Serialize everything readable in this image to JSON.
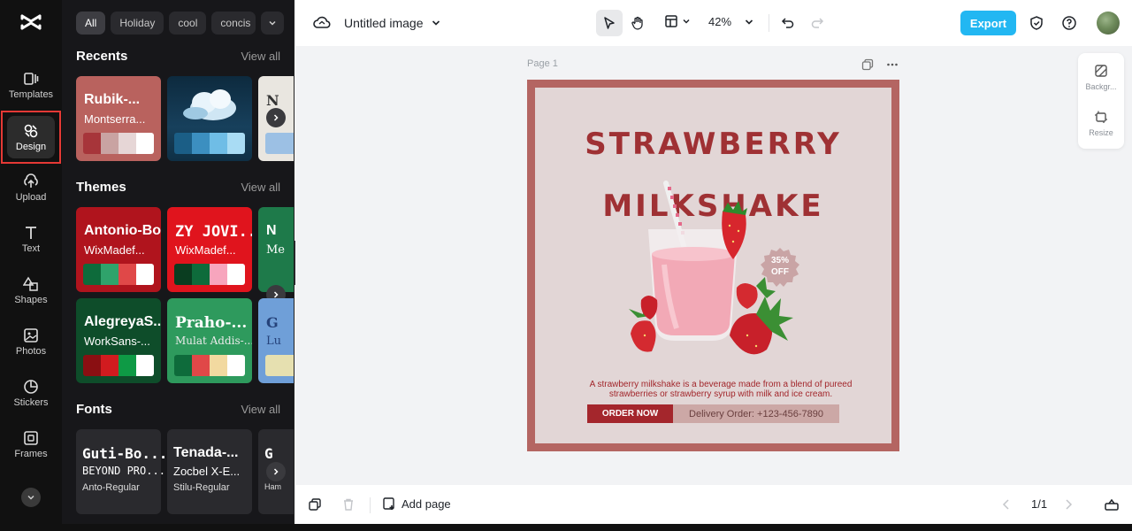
{
  "rail": {
    "items": [
      {
        "label": "Templates",
        "icon": "templates-icon"
      },
      {
        "label": "Design",
        "icon": "design-icon"
      },
      {
        "label": "Upload",
        "icon": "upload-icon"
      },
      {
        "label": "Text",
        "icon": "text-icon"
      },
      {
        "label": "Shapes",
        "icon": "shapes-icon"
      },
      {
        "label": "Photos",
        "icon": "photos-icon"
      },
      {
        "label": "Stickers",
        "icon": "stickers-icon"
      },
      {
        "label": "Frames",
        "icon": "frames-icon"
      }
    ]
  },
  "panel": {
    "chips": [
      "All",
      "Holiday",
      "cool",
      "concis"
    ],
    "recents": {
      "title": "Recents",
      "view_all": "View all",
      "cards": [
        {
          "title": "Rubik-...",
          "subtitle": "Montserra...",
          "bg": "#b9625e",
          "swatches": [
            "#a7353a",
            "#c9a3a2",
            "#e6d6d6",
            "#ffffff"
          ]
        },
        {
          "title": "",
          "subtitle": "",
          "bg": "#0f3045",
          "swatches": [
            "#1b5e86",
            "#3c8fc0",
            "#6fbde6",
            "#a9dcf4"
          ]
        },
        {
          "title": "N",
          "subtitle": "",
          "bg": "#e9e6e0",
          "swatches": [
            "#9cc0e4",
            "#9cc0e4",
            "#9cc0e4",
            "#9cc0e4"
          ]
        }
      ]
    },
    "themes": {
      "title": "Themes",
      "view_all": "View all",
      "cards": [
        {
          "title": "Antonio-Bold",
          "subtitle": "WixMadef...",
          "bg": "#b0141d",
          "swatches": [
            "#0e6b3b",
            "#2fa36b",
            "#e04848",
            "#ffffff"
          ]
        },
        {
          "title": "ZY JOVI...",
          "subtitle": "WixMadef...",
          "bg": "#e0141d",
          "swatches": [
            "#0a3d20",
            "#0e6b3b",
            "#f7a5bd",
            "#ffffff"
          ]
        },
        {
          "title": "N",
          "subtitle": "Me",
          "bg": "#1e7a4a",
          "swatches": []
        },
        {
          "title": "AlegreyaS...",
          "subtitle": "WorkSans-...",
          "bg": "#0e4d2a",
          "swatches": [
            "#8a0f12",
            "#d11b1f",
            "#0e9a45",
            "#ffffff"
          ]
        },
        {
          "title": "Praho-...",
          "subtitle": "Mulat Addis-...",
          "bg": "#2e9a5d",
          "swatches": [
            "#0e6b3b",
            "#e04848",
            "#f2d9a0",
            "#ffffff"
          ]
        },
        {
          "title": "G",
          "subtitle": "Lu",
          "bg": "#6f9fd8",
          "swatches": [
            "#e6e0b0"
          ]
        }
      ]
    },
    "fonts": {
      "title": "Fonts",
      "view_all": "View all",
      "cards": [
        {
          "l1": "Guti-Bo...",
          "l2": "BEYOND PRO...",
          "l3": "Anto-Regular"
        },
        {
          "l1": "Tenada-...",
          "l2": "Zocbel X-E...",
          "l3": "Stilu-Regular"
        },
        {
          "l1": "G",
          "l2": "",
          "l3": "Ham"
        }
      ]
    }
  },
  "topbar": {
    "title": "Untitled image",
    "zoom": "42%",
    "export_label": "Export"
  },
  "canvas": {
    "page_label": "Page 1",
    "design": {
      "headline_1": "STRAWBERRY",
      "headline_2": "MILKSHAKE",
      "discount_1": "35%",
      "discount_2": "OFF",
      "description": "A strawberry milkshake is a beverage made from a blend of pureed strawberries or strawberry syrup with milk and ice cream.",
      "order_button": "ORDER NOW",
      "delivery": "Delivery Order: +123-456-7890"
    }
  },
  "float_panel": {
    "background_label": "Backgr...",
    "resize_label": "Resize"
  },
  "bottombar": {
    "add_page": "Add page",
    "pager": "1/1"
  },
  "colors": {
    "accent": "#22b7f2",
    "design_border": "#b46562",
    "design_bg": "#e2d6d6",
    "headline": "#9f3134",
    "active_outline": "#e53935"
  }
}
